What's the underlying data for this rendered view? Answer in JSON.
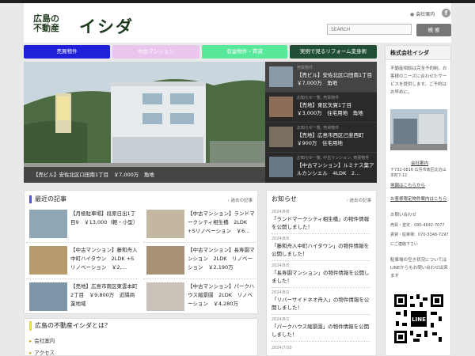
{
  "header": {
    "logo_line1": "広島の",
    "logo_line2": "不動産",
    "logo_big": "イシダ",
    "company_link": "会社案内",
    "search_placeholder": "SEARCH",
    "search_button": "検 索"
  },
  "nav": [
    {
      "label": "売買物件",
      "color": "#2020d8"
    },
    {
      "label": "中古マンション",
      "color": "#eac6ef"
    },
    {
      "label": "収益物件・賃貸",
      "color": "#58e89a"
    },
    {
      "label": "実例で見るリフォーム変身術",
      "color": "#214f35"
    }
  ],
  "slider": {
    "caption": "【売ビル】安佐北区口田南1丁目　￥7,000万　角地",
    "items": [
      {
        "category": "売買物件",
        "title": "【売ビル】安佐北区口田南1丁目 ￥7,000万　角地"
      },
      {
        "category": "お知らせ一覧, 売買物件",
        "title": "【売地】東区矢賀1丁目　￥3,000万　住宅用地　角地"
      },
      {
        "category": "お知らせ一覧, 売買物件",
        "title": "【売地】広島市西区己斐西町 ￥900万　住宅用地"
      },
      {
        "category": "お知らせ一覧, 中古マンション, 売買物件",
        "title": "【中古マンション】ルミナス葉アルカンシエル　4LDK　2…"
      }
    ]
  },
  "recent": {
    "title": "最近の記事",
    "more": "過去の記事",
    "articles": [
      {
        "title": "【月極駐車場】段原日出1丁目9　￥13,000（軽・小型）"
      },
      {
        "title": "【中古マンション】ランドマークシティ相生橋　2LDK +Sリノベーション　￥6…"
      },
      {
        "title": "【中古マンション】藤和舟入中町ハイタウン　2LDK +Sリノベーション　￥2,…"
      },
      {
        "title": "【中古マンション】長寿園マンション　2LDK　リノベーション　￥2,190万"
      },
      {
        "title": "【売地】広島市南区東雲本町2丁目　￥9,800万　近隣商業地域"
      },
      {
        "title": "【中古マンション】パークハウス縮景園　2LDK　リノベーション　￥4,280万"
      }
    ]
  },
  "news": {
    "title": "お知らせ",
    "more": "過去の記事",
    "items": [
      {
        "date": "2024/8/8",
        "title": "「ランドマークシティ相生橋」の物件情報を公開しました！"
      },
      {
        "date": "2024/8/5",
        "title": "「藤和舟入中町ハイタウン」の物件情報を公開しました！"
      },
      {
        "date": "2024/8/5",
        "title": "「長寿園マンション」の物件情報を公開しました！"
      },
      {
        "date": "2024/8/2",
        "title": "「リバーサイドネオ舟入」の物件情報を公開しました！"
      },
      {
        "date": "2024/8/1",
        "title": "「パークハウス縮景園」の物件情報を公開しました！"
      },
      {
        "date": "2024/7/30",
        "title": ""
      }
    ]
  },
  "sidebar": {
    "title": "株式会社イシダ",
    "intro": "不動産相談は完全予約制。お客様のニーズに合わせたサービスを提供します。ご予約はお早めに。",
    "company_link": "会社案内",
    "address": "〒732-0816 広島市南区比治山本町7-12",
    "map_link": "地図はこちらから",
    "purchase_link": "お客様限定物件案内はこちら",
    "contact_heading": "お問い合わせ",
    "tel_sales": "売買・査定：090-4642-7077",
    "tel_rent": "賃貸・駐車場：070-3348-7297",
    "tel_note": "にご連絡下さい",
    "line_note": "駐車場の空き状況についてはLINEからもお問い合わせ出来ます"
  },
  "about": {
    "title": "広島の不動産イシダとは？",
    "items": [
      "会社案内",
      "アクセス"
    ]
  }
}
